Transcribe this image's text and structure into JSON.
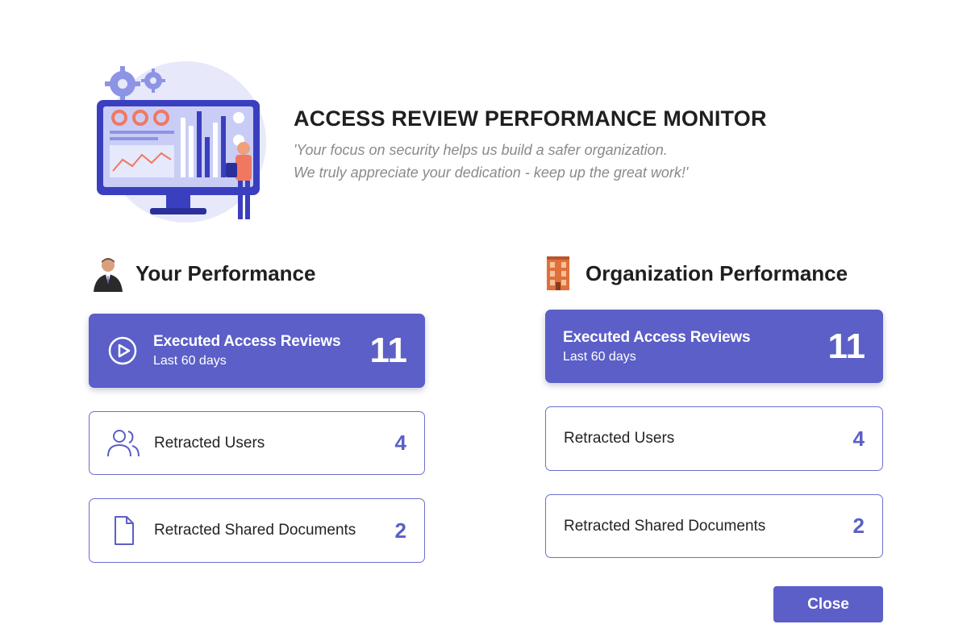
{
  "header": {
    "title": "ACCESS REVIEW PERFORMANCE MONITOR",
    "quote_line1": "'Your focus on security helps us build a safer organization.",
    "quote_line2": "We truly appreciate your dedication - keep up the great work!'"
  },
  "your_performance": {
    "heading": "Your Performance",
    "icon": "user-photo-icon",
    "executed": {
      "label": "Executed Access Reviews",
      "sub": "Last 60 days",
      "value": "11",
      "icon": "play-circle-icon"
    },
    "retracted_users": {
      "label": "Retracted Users",
      "value": "4",
      "icon": "people-icon"
    },
    "retracted_docs": {
      "label": "Retracted Shared Documents",
      "value": "2",
      "icon": "document-icon"
    }
  },
  "org_performance": {
    "heading": "Organization Performance",
    "icon": "office-building-icon",
    "executed": {
      "label": "Executed Access Reviews",
      "sub": "Last 60 days",
      "value": "11"
    },
    "retracted_users": {
      "label": "Retracted Users",
      "value": "4"
    },
    "retracted_docs": {
      "label": "Retracted Shared Documents",
      "value": "2"
    }
  },
  "footer": {
    "close_label": "Close"
  },
  "colors": {
    "accent": "#5b5fc7",
    "quote": "#8a8a8a",
    "text": "#242424"
  }
}
